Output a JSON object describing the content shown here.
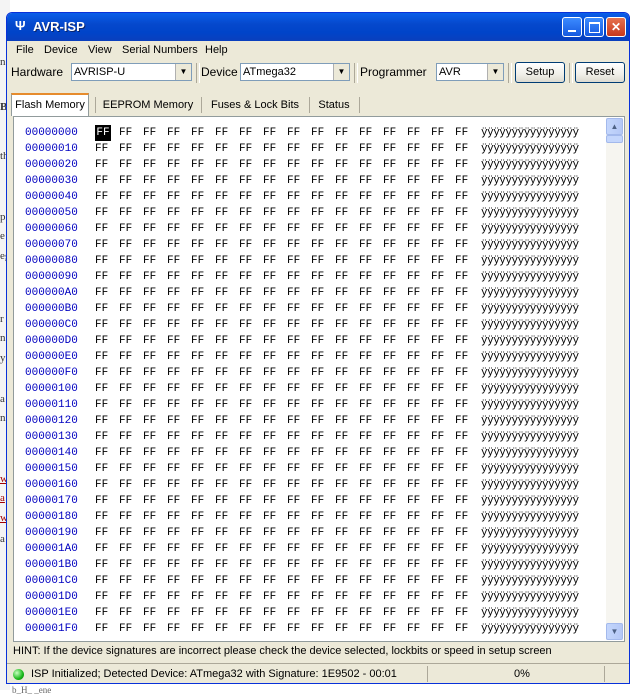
{
  "window": {
    "title": "AVR-ISP"
  },
  "menu": [
    "File",
    "Device",
    "View",
    "Serial Numbers",
    "Help"
  ],
  "toolbar": {
    "hardware_label": "Hardware",
    "hardware_value": "AVRISP-U",
    "device_label": "Device",
    "device_value": "ATmega32",
    "programmer_label": "Programmer",
    "programmer_value": "AVR",
    "setup_label": "Setup",
    "reset_label": "Reset"
  },
  "tabs": [
    "Flash Memory",
    "EEPROM Memory",
    "Fuses & Lock Bits",
    "Status"
  ],
  "hex": {
    "addresses": [
      "00000000",
      "00000010",
      "00000020",
      "00000030",
      "00000040",
      "00000050",
      "00000060",
      "00000070",
      "00000080",
      "00000090",
      "000000A0",
      "000000B0",
      "000000C0",
      "000000D0",
      "000000E0",
      "000000F0",
      "00000100",
      "00000110",
      "00000120",
      "00000130",
      "00000140",
      "00000150",
      "00000160",
      "00000170",
      "00000180",
      "00000190",
      "000001A0",
      "000001B0",
      "000001C0",
      "000001D0",
      "000001E0",
      "000001F0"
    ],
    "byte_value": "FF",
    "ascii_value": "ÿÿÿÿÿÿÿÿÿÿÿÿÿÿÿÿ"
  },
  "hint": "HINT: If the device signatures are incorrect please check the device selected, lockbits or speed in setup screen",
  "status": {
    "text": "ISP Initialized; Detected Device: ATmega32 with Signature: 1E9502 - 00:01",
    "percent": "0%",
    "led_color": "#18b818"
  },
  "background": {
    "fragments": [
      "n",
      "B",
      "th",
      "p",
      "e",
      "eg",
      "r",
      "n",
      "y",
      "a",
      "ni",
      "w",
      "a",
      "w",
      "a",
      "b_H_ _ene"
    ]
  }
}
